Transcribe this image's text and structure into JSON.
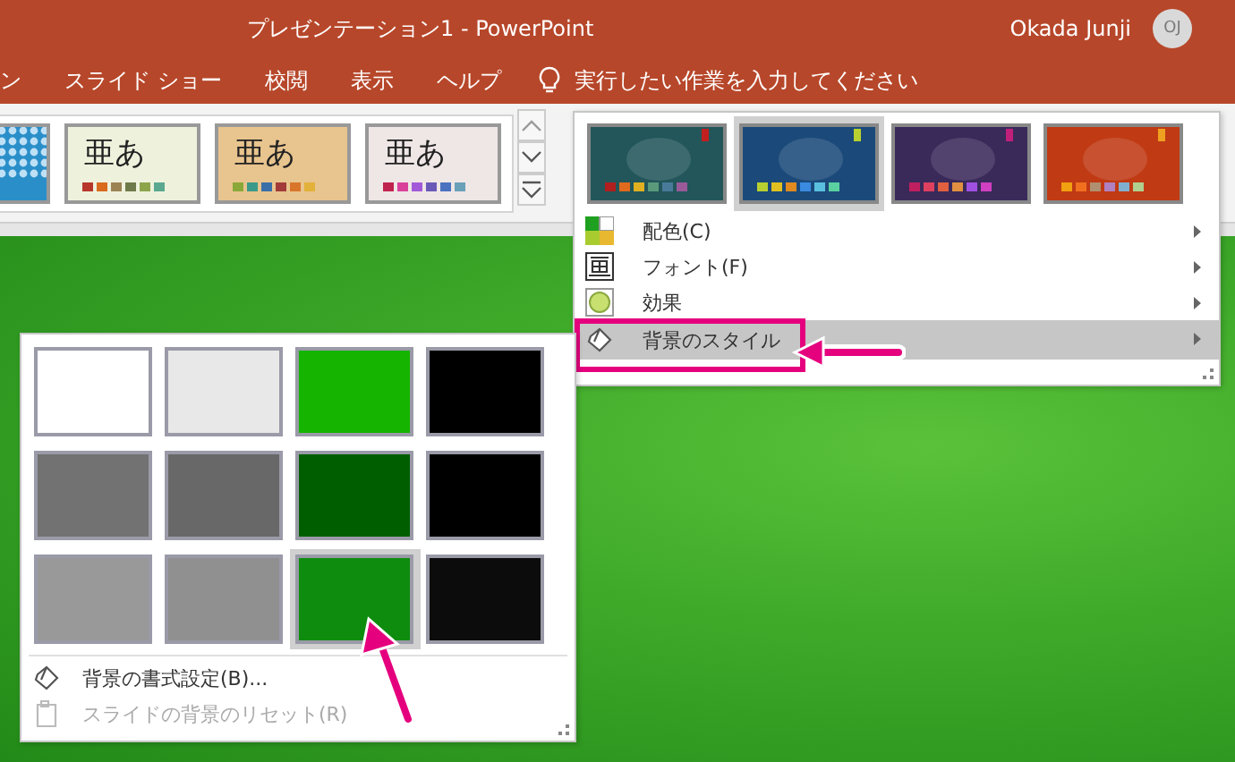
{
  "window": {
    "title": "プレゼンテーション1  -  PowerPoint",
    "user": "Okada Junji",
    "user_initials": "OJ"
  },
  "tabs": [
    {
      "label": "ン",
      "selected": false
    },
    {
      "label": "スライド ショー",
      "selected": false
    },
    {
      "label": "校閲",
      "selected": false
    },
    {
      "label": "表示",
      "selected": false
    },
    {
      "label": "ヘルプ",
      "selected": false
    }
  ],
  "tell_me": {
    "placeholder": "実行したい作業を入力してください"
  },
  "themes": [
    {
      "kind": "pattern",
      "color": "#2a8fc9"
    },
    {
      "kind": "sample",
      "label": "亜あ",
      "color": "#eef2dc",
      "swatches": [
        {
          "color": "#b7372a"
        },
        {
          "color": "#d96a1e"
        },
        {
          "color": "#9c8354"
        },
        {
          "color": "#6f7a4a"
        },
        {
          "color": "#8ca44a"
        },
        {
          "color": "#5aa890"
        }
      ]
    },
    {
      "kind": "sample",
      "label": "亜あ",
      "color": "#e8c48e",
      "swatches": [
        {
          "color": "#8aa838"
        },
        {
          "color": "#3b9a8a"
        },
        {
          "color": "#3a6fa8"
        },
        {
          "color": "#a33a3a"
        },
        {
          "color": "#d9752a"
        },
        {
          "color": "#e2b13a"
        }
      ]
    },
    {
      "kind": "sample",
      "label": "亜あ",
      "color": "#efe6e6",
      "swatches": [
        {
          "color": "#c0234e"
        },
        {
          "color": "#d9409a"
        },
        {
          "color": "#a35ad9"
        },
        {
          "color": "#6a5ab8"
        },
        {
          "color": "#4a72c0"
        },
        {
          "color": "#6aa0b8"
        }
      ]
    }
  ],
  "variants": [
    {
      "color": "#22565a",
      "selected": false,
      "tag": {
        "color": "#c0201e"
      },
      "swatches": [
        {
          "color": "#b01e1e"
        },
        {
          "color": "#e06a1e"
        },
        {
          "color": "#e0b020"
        },
        {
          "color": "#5a9a7a"
        },
        {
          "color": "#4a7a9a"
        },
        {
          "color": "#9a5a9a"
        }
      ]
    },
    {
      "color": "#1b4a7a",
      "selected": true,
      "tag": {
        "color": "#b8d030"
      },
      "swatches": [
        {
          "color": "#b8d030"
        },
        {
          "color": "#e0c020"
        },
        {
          "color": "#e08a20"
        },
        {
          "color": "#3a8ae0"
        },
        {
          "color": "#5ac0e0"
        },
        {
          "color": "#5ad0a0"
        }
      ]
    },
    {
      "color": "#3a2a5a",
      "selected": false,
      "tag": {
        "color": "#c0207a"
      },
      "swatches": [
        {
          "color": "#c02060"
        },
        {
          "color": "#e04060"
        },
        {
          "color": "#e06040"
        },
        {
          "color": "#e09040"
        },
        {
          "color": "#a050e0"
        },
        {
          "color": "#d040c0"
        }
      ]
    },
    {
      "color": "#c03a14",
      "selected": false,
      "tag": {
        "color": "#f0a020"
      },
      "swatches": [
        {
          "color": "#f0a010"
        },
        {
          "color": "#f07020"
        },
        {
          "color": "#b09070"
        },
        {
          "color": "#b080c0"
        },
        {
          "color": "#80b0d0"
        },
        {
          "color": "#b0d090"
        }
      ]
    }
  ],
  "variant_menu": [
    {
      "kind": "colors",
      "label": "配色(C)",
      "selected": false
    },
    {
      "kind": "fonts",
      "label": "フォント(F)",
      "selected": false
    },
    {
      "kind": "effects",
      "label": "効果",
      "selected": false
    },
    {
      "kind": "background",
      "label": "背景のスタイル",
      "selected": true
    }
  ],
  "background_styles": [
    {
      "color": "#ffffff",
      "selected": false
    },
    {
      "color": "#e8e8e8",
      "selected": false
    },
    {
      "color": "#14b400",
      "selected": false
    },
    {
      "color": "#000000",
      "selected": false
    },
    {
      "color": "#727272",
      "selected": false
    },
    {
      "color": "#686868",
      "selected": false
    },
    {
      "color": "#005e00",
      "selected": false
    },
    {
      "color": "#000000",
      "selected": false
    },
    {
      "color": "#999999",
      "selected": false
    },
    {
      "color": "#909090",
      "selected": false
    },
    {
      "color": "#0e8c0e",
      "selected": true
    },
    {
      "color": "#0c0c0c",
      "selected": false
    }
  ],
  "background_actions": [
    {
      "kind": "format",
      "label": "背景の書式設定(B)...",
      "disabled": false
    },
    {
      "kind": "reset",
      "label": "スライドの背景のリセット(R)",
      "disabled": true
    }
  ]
}
